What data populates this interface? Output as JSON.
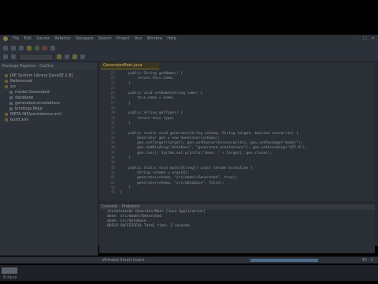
{
  "menubar": {
    "items": [
      "File",
      "Edit",
      "Source",
      "Refactor",
      "Navigate",
      "Search",
      "Project",
      "Run",
      "Window",
      "Help"
    ]
  },
  "window": {
    "controls": [
      "–",
      "□",
      "✕"
    ]
  },
  "left_panel": {
    "tabs": [
      "Package Explorer",
      "Outline"
    ],
    "tree": [
      {
        "label": "JRE System Library [JavaSE-1.8]",
        "type": "folder"
      },
      {
        "label": "Referenced",
        "type": "folder"
      },
      {
        "label": "src",
        "type": "folder"
      },
      {
        "label": "model.Generated",
        "type": "package"
      },
      {
        "label": "database",
        "type": "package"
      },
      {
        "label": "generated.annotations",
        "type": "package"
      },
      {
        "label": "bindings.Mojo",
        "type": "package"
      },
      {
        "label": "META-INF/persistence.xml",
        "type": "file"
      },
      {
        "label": "build.xml",
        "type": "file"
      }
    ]
  },
  "editor": {
    "tab_label": "GeneratorMain.java",
    "line_numbers": [
      "21",
      "22",
      "23",
      "24",
      "25",
      "26",
      "27",
      "28",
      "29",
      "30",
      "31",
      "32",
      "33",
      "34",
      "35",
      "36",
      "37",
      "38",
      "39",
      "40",
      "41",
      "42",
      "43",
      "44",
      "45"
    ],
    "lines": [
      "    public String getName() {",
      "        return this.name;",
      "    }",
      "",
      "    public void setName(String name) {",
      "        this.name = name;",
      "    }",
      "",
      "    public String getType() {",
      "        return this.type;",
      "    }",
      "",
      "    public static void generate(String schema, String target, boolean overwrite) {",
      "        Generator gen = new Generator(schema);",
      "        gen.setTarget(target); gen.setOverwrite(overwrite); gen.setPackage(\"model\");",
      "        gen.addBinding(\"database\", \"generated.annotations\"); gen.setEncoding(\"UTF-8\");",
      "        gen.run(); System.out.println(\"done: \" + target); gen.close();",
      "    }",
      "",
      "    public static void main(String[] args) throws Exception {",
      "        String schema = args[0];",
      "        generate(schema, \"src/model/Generated\", true);",
      "        generate(schema, \"src/database\", false);",
      "    }",
      "}"
    ]
  },
  "console": {
    "tabs": [
      "Console",
      "Problems"
    ],
    "lines": [
      "<terminated> GeneratorMain [Java Application]",
      "done: src/model/Generated",
      "done: src/database",
      "BUILD SUCCESSFUL Total time: 2 seconds"
    ]
  },
  "statusbar": {
    "left_text": "Writable    Smart Insert",
    "right_text": "45 : 2",
    "progress": 1.0
  },
  "taskbar": {
    "label": "Eclipse"
  }
}
